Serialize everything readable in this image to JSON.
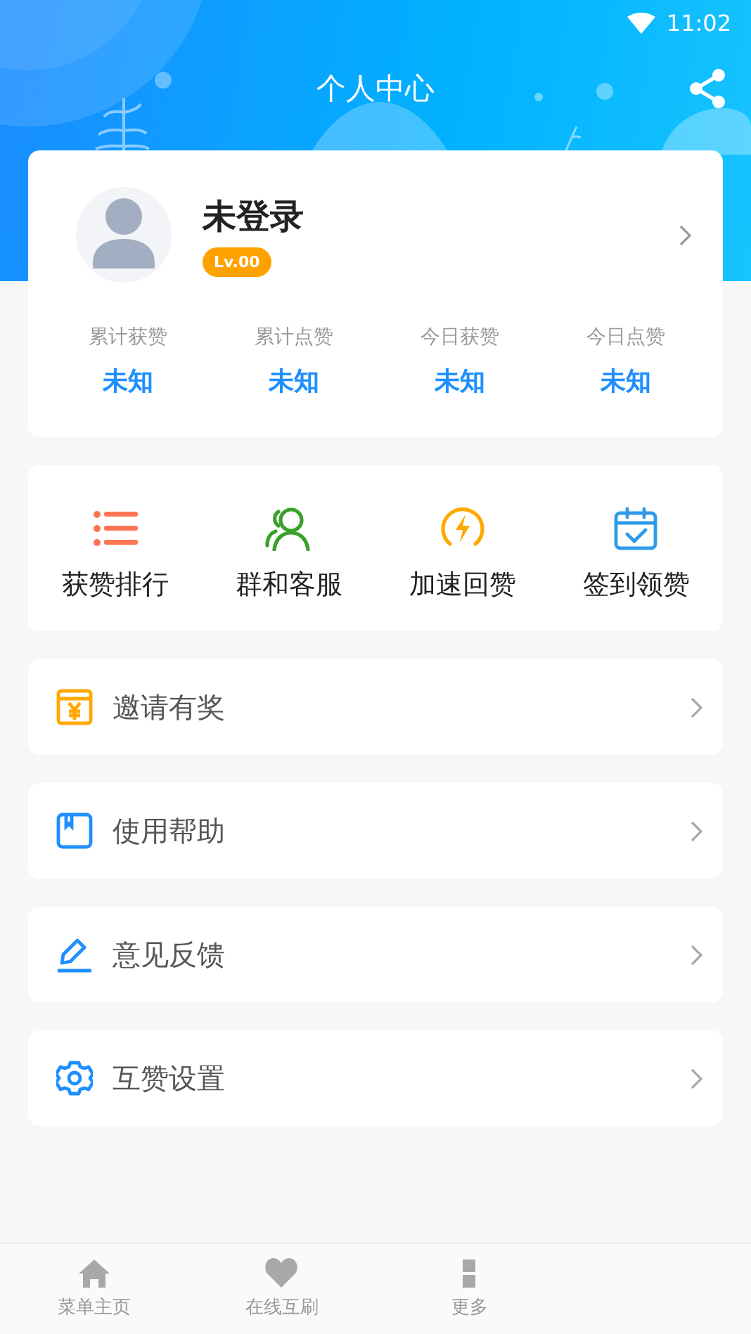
{
  "status_bar": {
    "time": "11:02"
  },
  "header": {
    "title": "个人中心"
  },
  "profile": {
    "name": "未登录",
    "level_badge": "Lv.00",
    "stats": [
      {
        "label": "累计获赞",
        "value": "未知"
      },
      {
        "label": "累计点赞",
        "value": "未知"
      },
      {
        "label": "今日获赞",
        "value": "未知"
      },
      {
        "label": "今日点赞",
        "value": "未知"
      }
    ]
  },
  "quick_actions": [
    {
      "label": "获赞排行",
      "kind": "list",
      "color": "#ff7452"
    },
    {
      "label": "群和客服",
      "kind": "users",
      "color": "#3aa12a"
    },
    {
      "label": "加速回赞",
      "kind": "bolt",
      "color": "#ffa800"
    },
    {
      "label": "签到领赞",
      "kind": "calendar",
      "color": "#2f9be8"
    }
  ],
  "menu": [
    {
      "label": "邀请有奖",
      "kind": "gift",
      "color": "#ffa800"
    },
    {
      "label": "使用帮助",
      "kind": "book",
      "color": "#1e8fff"
    },
    {
      "label": "意见反馈",
      "kind": "edit",
      "color": "#1e8fff"
    },
    {
      "label": "互赞设置",
      "kind": "gear",
      "color": "#1e8fff"
    }
  ],
  "bottom_nav": [
    {
      "label": "菜单主页",
      "kind": "home"
    },
    {
      "label": "在线互刷",
      "kind": "heart"
    },
    {
      "label": "更多",
      "kind": "grid"
    }
  ]
}
